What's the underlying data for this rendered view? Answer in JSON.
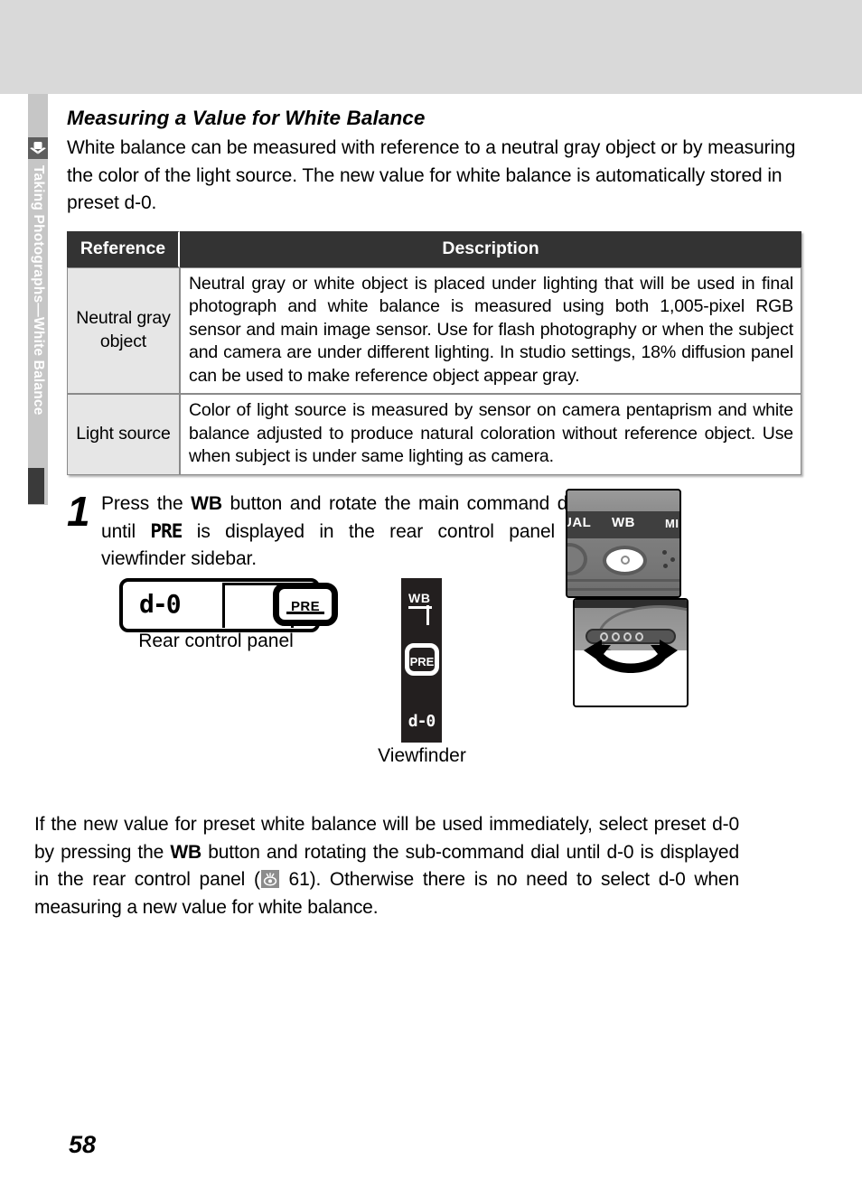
{
  "page": {
    "number": "58",
    "chapter_tab": "Taking Photographs—White Balance",
    "chapter_icon": "camera-icon"
  },
  "section": {
    "title": "Measuring a Value for White Balance",
    "intro": "White balance can be measured with reference to a neutral gray object or by measuring the color of the light source.  The new value for white balance is automatically stored in preset d-0."
  },
  "table": {
    "headers": [
      "Reference",
      "Description"
    ],
    "rows": [
      {
        "reference": "Neutral gray object",
        "description": "Neutral gray or white object is placed under lighting that will be used in final photograph and white balance is measured using both 1,005-pixel RGB sensor and main image sensor.  Use for flash photography or when the subject and camera are under different lighting.  In studio settings, 18% diffusion panel can be used to make reference object appear gray."
      },
      {
        "reference": "Light source",
        "description": "Color of light source is measured by sensor on camera pentaprism and white balance adjusted to produce natural coloration without reference object.  Use when subject is under same lighting as camera."
      }
    ]
  },
  "step": {
    "number": "1",
    "text_part1": "Press the ",
    "bold1": "WB",
    "text_part2": " button and rotate the main command dial until ",
    "lcd_pre": "PRE",
    "text_part3": " is displayed in the rear control panel or viewfinder sidebar."
  },
  "photos": {
    "wb_button_photo": {
      "label_left": "UAL",
      "label_center": "WB",
      "label_right": "MI"
    },
    "dial_photo": {
      "alt": "main-command-dial-rotation"
    }
  },
  "diagrams": {
    "rear_panel": {
      "value": "d-0",
      "pre_label": "PRE",
      "caption": "Rear control panel"
    },
    "viewfinder": {
      "wb_label": "WB",
      "pre_label": "PRE",
      "value": "d-0",
      "caption": "Viewfinder"
    }
  },
  "closing": {
    "part1": "If the new value for preset white balance will be used immediately, select preset d-0 by pressing the ",
    "bold1": "WB",
    "part2": " button and rotating the sub-command dial until d-0 is displayed in the rear control panel (",
    "ref_icon": "viewfinder-eye-icon",
    "ref_page": " 61).  Otherwise there is no need to select d-0 when measuring a new value for white balance."
  },
  "colors": {
    "top_band": "#d9d9d9",
    "tab_bg": "#c6c6c6",
    "tab_icon_bg": "#5e5e5e",
    "table_header_bg": "#333333",
    "table_ref_bg": "#e6e6e6",
    "viewfinder_bg": "#231f1f"
  }
}
